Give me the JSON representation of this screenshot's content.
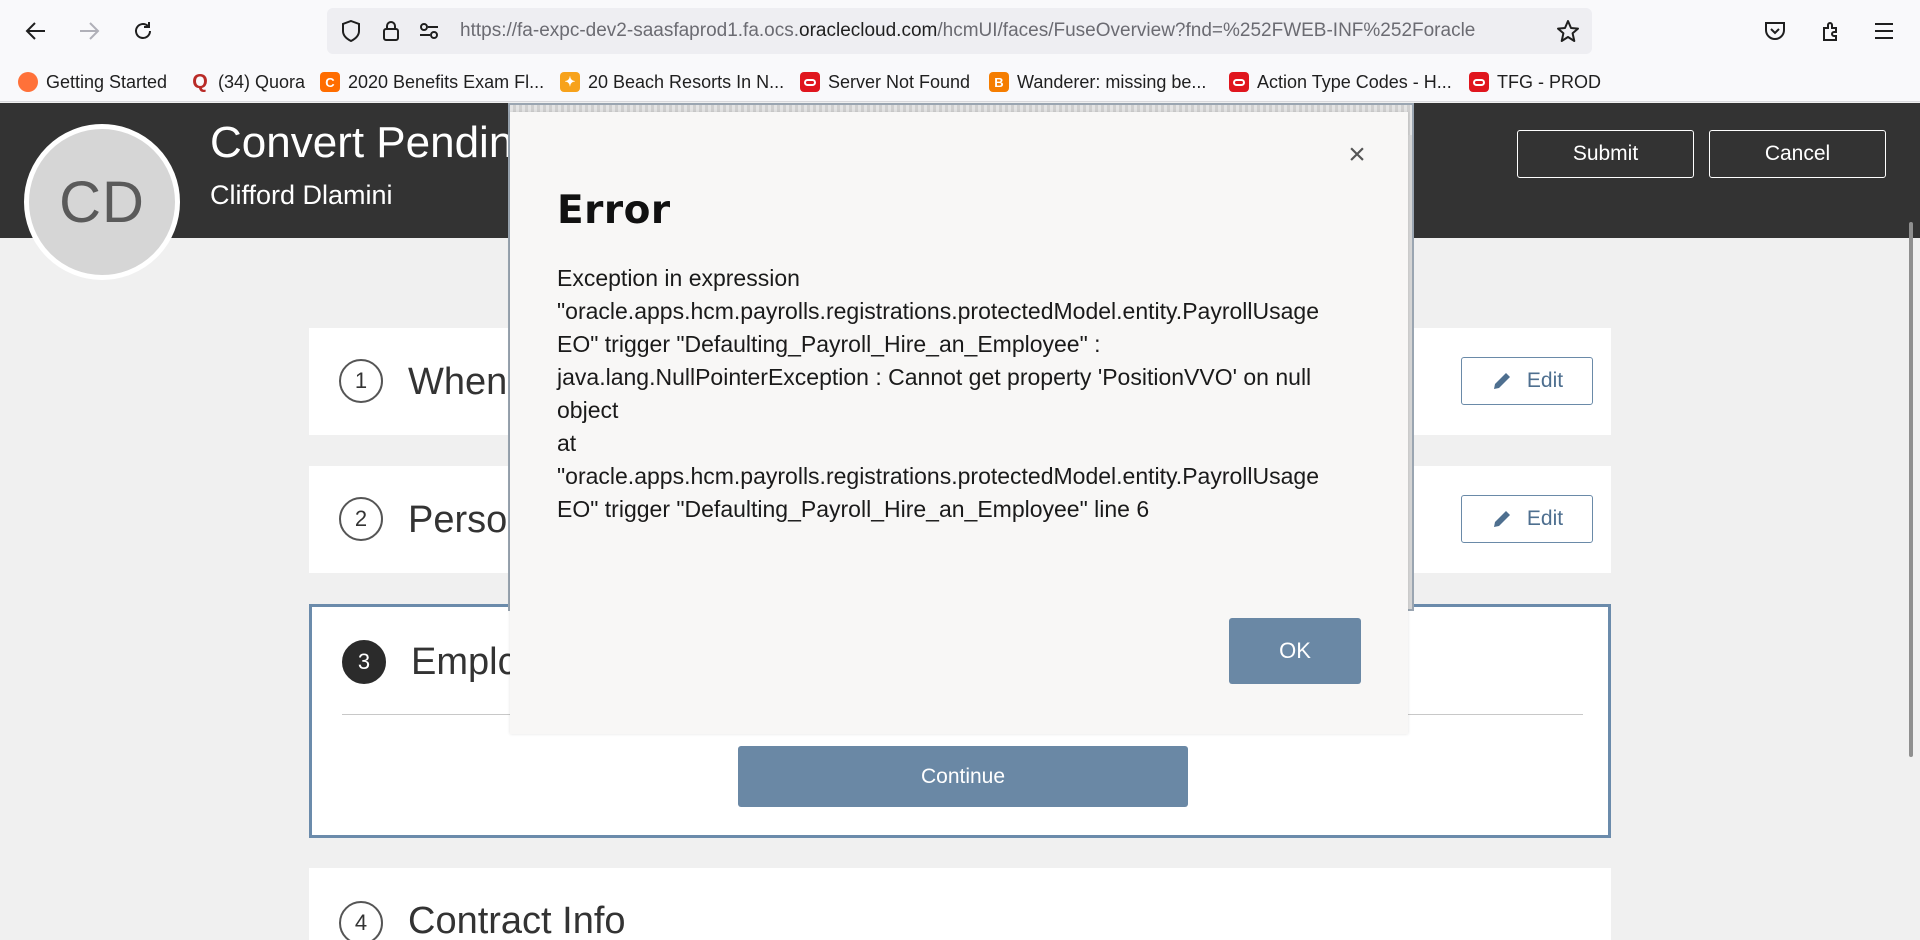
{
  "browser": {
    "url_prefix": "https://fa-expc-dev2-saasfaprod1.fa.ocs.",
    "url_domain": "oraclecloud.com",
    "url_suffix": "/hcmUI/faces/FuseOverview?fnd=%252FWEB-INF%252Foracle",
    "bookmarks": [
      {
        "label": "Getting Started",
        "icon": "firefox-icon",
        "color": "#ff7139"
      },
      {
        "label": "(34) Quora",
        "icon": "quora-icon",
        "color": "#b92b27"
      },
      {
        "label": "2020 Benefits Exam Fl...",
        "icon": "c-icon",
        "color": "#ff6d00"
      },
      {
        "label": "20 Beach Resorts In N...",
        "icon": "resort-icon",
        "color": "#f7a21b"
      },
      {
        "label": "Server Not Found",
        "icon": "oracle-icon",
        "color": "#e0161e"
      },
      {
        "label": "Wanderer: missing be...",
        "icon": "blogger-icon",
        "color": "#f57d00"
      },
      {
        "label": "Action Type Codes - H...",
        "icon": "oracle-icon",
        "color": "#e0161e"
      },
      {
        "label": "TFG - PROD",
        "icon": "oracle-icon",
        "color": "#e0161e"
      }
    ]
  },
  "header": {
    "avatar_initials": "CD",
    "title": "Convert Pending",
    "person_name": "Clifford Dlamini",
    "submit_label": "Submit",
    "cancel_label": "Cancel"
  },
  "sections": [
    {
      "number": "1",
      "title": "When",
      "edit_label": "Edit"
    },
    {
      "number": "2",
      "title": "Person",
      "edit_label": "Edit"
    },
    {
      "number": "3",
      "title": "Emplc"
    },
    {
      "number": "4",
      "title": "Contract Info"
    }
  ],
  "continue_label": "Continue",
  "dialog": {
    "close_symbol": "×",
    "title": "Error",
    "message_lines": [
      "Exception in expression",
      "\"oracle.apps.hcm.payrolls.registrations.protectedModel.entity.PayrollUsage",
      "EO\" trigger \"Defaulting_Payroll_Hire_an_Employee\" :",
      "java.lang.NullPointerException : Cannot get property 'PositionVVO' on null",
      "object",
      "at",
      "\"oracle.apps.hcm.payrolls.registrations.protectedModel.entity.PayrollUsage",
      "EO\" trigger \"Defaulting_Payroll_Hire_an_Employee\" line 6"
    ],
    "ok_label": "OK"
  },
  "colors": {
    "header_bg": "#333333",
    "accent_blue": "#6a88a5"
  }
}
